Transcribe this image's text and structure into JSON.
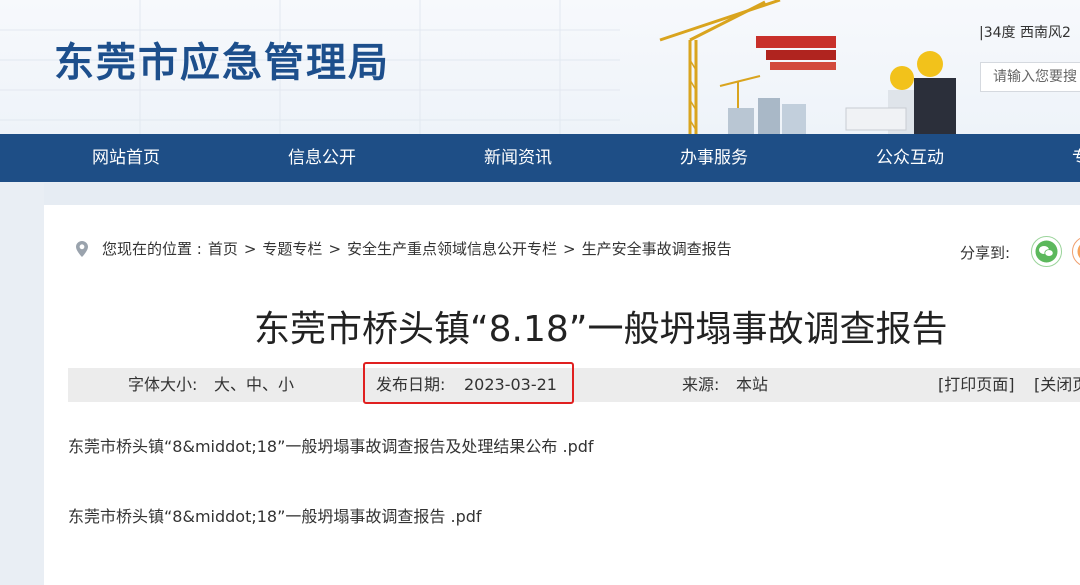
{
  "header": {
    "site_title": "东莞市应急管理局",
    "weather": "|34度 西南风2",
    "search_placeholder": "请输入您要搜"
  },
  "nav": {
    "items": [
      {
        "label": "网站首页"
      },
      {
        "label": "信息公开"
      },
      {
        "label": "新闻资讯"
      },
      {
        "label": "办事服务"
      },
      {
        "label": "公众互动"
      },
      {
        "label": "专"
      }
    ]
  },
  "breadcrumb": {
    "prefix": "您现在的位置 : ",
    "items": [
      "首页",
      "专题专栏",
      "安全生产重点领域信息公开专栏",
      "生产安全事故调查报告"
    ],
    "separator": ">"
  },
  "share": {
    "label": "分享到:",
    "icons": [
      "wechat-icon",
      "share-more-icon"
    ]
  },
  "article": {
    "title": "东莞市桥头镇“8.18”一般坍塌事故调查报告",
    "meta": {
      "font_size_label": "字体大小:",
      "font_size_options": "大、中、小",
      "date_label": "发布日期:",
      "date": "2023-03-21",
      "source_label": "来源:",
      "source": "本站",
      "print": "[打印页面]",
      "close": "[关闭页"
    },
    "files": [
      {
        "name": "东莞市桥头镇“8&middot;18”一般坍塌事故调查报告及处理结果公布 .pdf"
      },
      {
        "name": "东莞市桥头镇“8&middot;18”一般坍塌事故调查报告 .pdf"
      }
    ]
  },
  "colors": {
    "nav_bg": "#1e4e86",
    "title_blue": "#1d4f8c",
    "highlight": "#e02020"
  }
}
